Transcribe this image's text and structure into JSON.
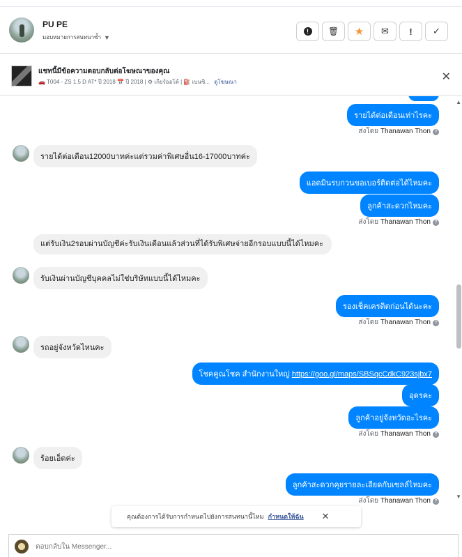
{
  "contact": {
    "name": "PU PE",
    "assign_label": "มอบหมายการสนทนาซ้ำ"
  },
  "actions": [
    {
      "name": "spam",
      "icon": "!"
    },
    {
      "name": "delete",
      "icon": "🗑"
    },
    {
      "name": "star",
      "icon": "★"
    },
    {
      "name": "email",
      "icon": "✉"
    },
    {
      "name": "followup",
      "icon": "!"
    },
    {
      "name": "done",
      "icon": "✓"
    }
  ],
  "ad": {
    "title": "แชทนี้มีข้อความตอบกลับต่อโฆษณาของคุณ",
    "meta": "🚗 T004 - ZS 1.5 D AT* ปี 2018 📅 ปี 2018 | ⚙ เกียร์ออโต้ | ⛽ เบนซิ...",
    "link": "ดูโฆษณา"
  },
  "messages": {
    "m1": "รายได้ต่อเดือนเท่าไรคะ",
    "sent1": "ส่งโดย",
    "sender": "Thanawan Thon",
    "m2": "รายได้ต่อเดือน12000บาทค่ะแต่รวมค่าพิเศษอื่น16-17000บาทค่ะ",
    "m3": "แอดมินรบกวนขอเบอร์ติดต่อได้ไหมคะ",
    "m4": "ลูกค้าสะดวกไหมคะ",
    "m5": "แต่รับเงิน2รอบผ่านบัญชีค่ะรับเงินเดือนแล้วส่วนที่ได้รับพิเศษจ่ายอีกรอบแบบนี้ได้ไหมคะ",
    "m6": "รับเงินผ่านบัญชีบุคคลไม่ใช่บริษัทแบบนี้ได้ไหมคะ",
    "m7": "รองเช็คเครดิตก่อนได้นะคะ",
    "m8": "รถอยู่จังหวัดไหนคะ",
    "m9_text": "โชคคูณโชค สำนักงานใหญ่ ",
    "m9_link": "https://goo.gl/maps/SBSqcCdkC923sjbx7",
    "m10": "อุดรคะ",
    "m11": "ลูกค้าอยู่จังหวัดอะไรคะ",
    "m12": "ร้อยเอ็ดค่ะ",
    "m13": "ลูกค้าสะดวกคุยรายละเอียดกับเซลล์ไหมคะ"
  },
  "toast": {
    "text": "คุณต้องการได้รับการกำหนดไปยังการสนทนานี้ไหม",
    "link": "กำหนดให้ฉัน"
  },
  "composer": {
    "placeholder": "ตอบกลับใน Messenger..."
  },
  "colors": {
    "outgoing": "#0084ff",
    "incoming": "#f1f0f0"
  }
}
